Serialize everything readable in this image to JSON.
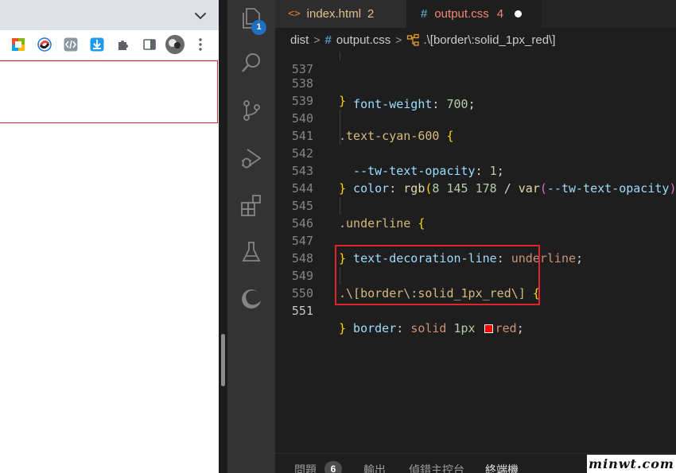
{
  "browser": {
    "extensions": [
      "office-icon",
      "sync-icon",
      "code-icon",
      "download-icon",
      "puzzle-icon",
      "side-panel-icon"
    ]
  },
  "editor_tabs": [
    {
      "icon": "<>",
      "name": "index.html",
      "problems": "2"
    },
    {
      "icon": "#",
      "name": "output.css",
      "problems": "4",
      "dirty": true
    }
  ],
  "activity_bar": {
    "explorer_badge": "1"
  },
  "breadcrumb": {
    "folder": "dist",
    "file": "output.css",
    "symbol": ".\\[border\\:solid_1px_red\\]"
  },
  "code_lines": [
    {
      "n": "537",
      "text": "  font-weight: 700;"
    },
    {
      "n": "538",
      "text": "}"
    },
    {
      "n": "539",
      "text": ""
    },
    {
      "n": "540",
      "text": ".text-cyan-600 {"
    },
    {
      "n": "541",
      "text": "  --tw-text-opacity: 1;"
    },
    {
      "n": "542",
      "text": "  color: rgb(8 145 178 / var(--tw-text-opacity));"
    },
    {
      "n": "543",
      "text": "}"
    },
    {
      "n": "544",
      "text": ""
    },
    {
      "n": "545",
      "text": ".underline {"
    },
    {
      "n": "546",
      "text": "  text-decoration-line: underline;"
    },
    {
      "n": "547",
      "text": "}"
    },
    {
      "n": "548",
      "text": ""
    },
    {
      "n": "549",
      "text": ".\\[border\\:solid_1px_red\\] {"
    },
    {
      "n": "550",
      "text": "  border: solid 1px red;"
    },
    {
      "n": "551",
      "text": "}"
    }
  ],
  "panel": {
    "problems_label": "問題",
    "problems_count": "6",
    "output_label": "輸出",
    "debug_label": "偵錯主控台",
    "terminal_label": "終端機"
  },
  "watermark": "minwt.com",
  "colors": {
    "highlight_box": "#e0262c",
    "color_swatch": "#ff0000"
  }
}
